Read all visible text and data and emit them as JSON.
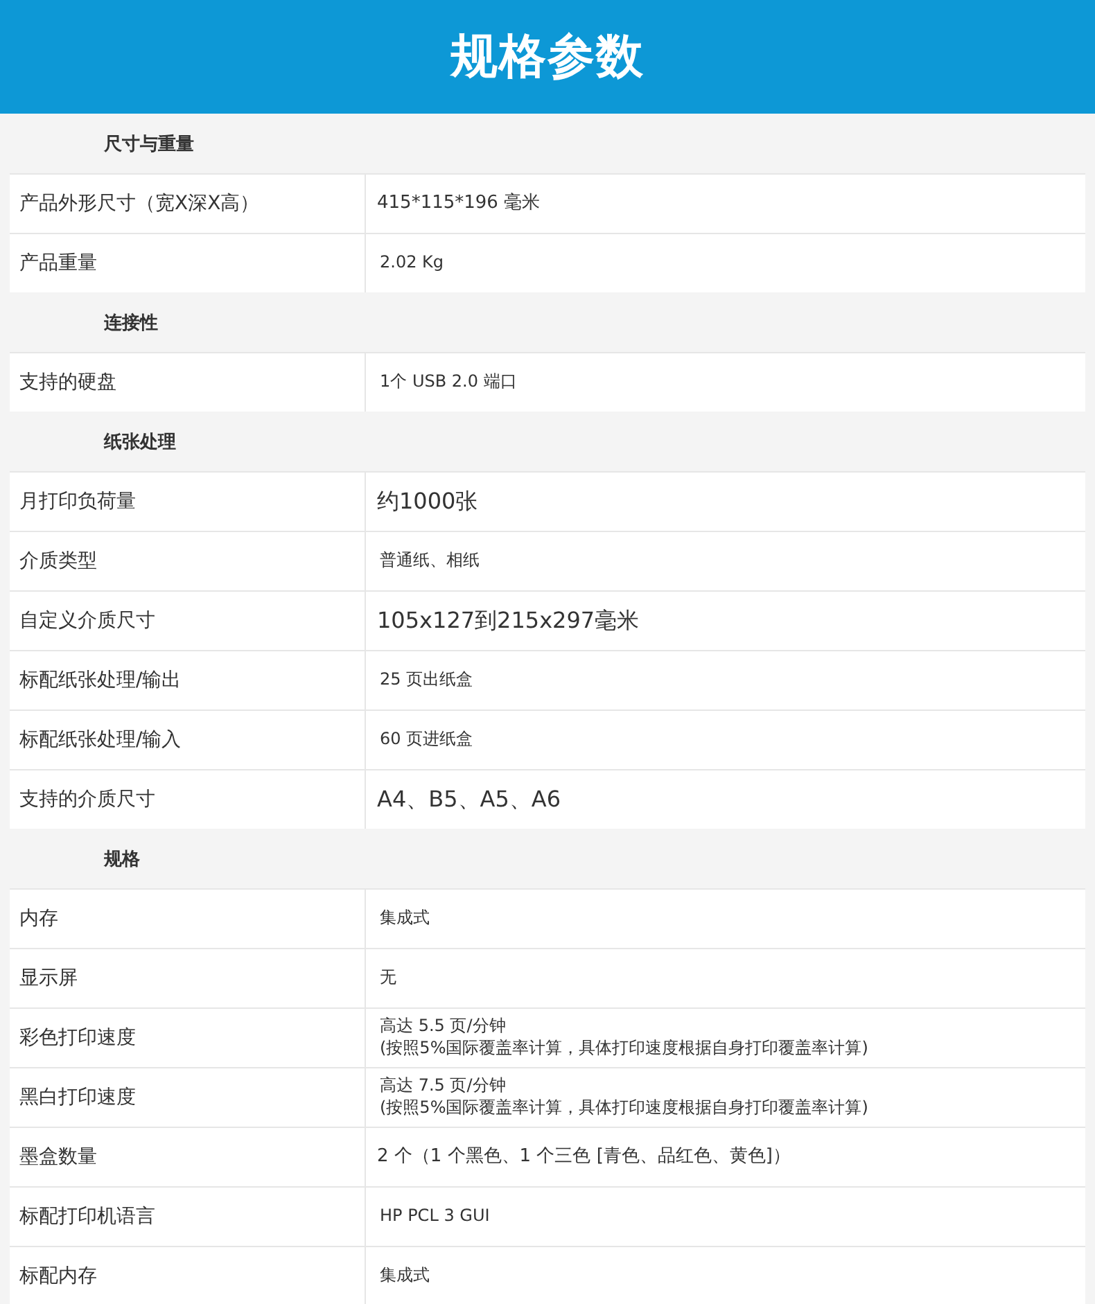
{
  "header": {
    "title": "规格参数"
  },
  "sections": [
    {
      "title": "尺寸与重量",
      "rows": [
        {
          "label": "产品外形尺寸（宽X深X高）",
          "kind": "medium",
          "lines": [
            "415*115*196  毫米"
          ]
        },
        {
          "label": "产品重量",
          "kind": "plain",
          "lines": [
            "2.02 Kg"
          ]
        }
      ]
    },
    {
      "title": "连接性",
      "rows": [
        {
          "label": "支持的硬盘",
          "kind": "plain",
          "lines": [
            "1个 USB 2.0 端口"
          ]
        }
      ]
    },
    {
      "title": "纸张处理",
      "rows": [
        {
          "label": "月打印负荷量",
          "kind": "large",
          "lines": [
            "约1000张"
          ]
        },
        {
          "label": "介质类型",
          "kind": "plain",
          "lines": [
            "普通纸、相纸"
          ]
        },
        {
          "label": "自定义介质尺寸",
          "kind": "large",
          "lines": [
            "105x127到215x297毫米"
          ]
        },
        {
          "label": "标配纸张处理/输出",
          "kind": "plain",
          "lines": [
            "25 页出纸盒"
          ]
        },
        {
          "label": "标配纸张处理/输入",
          "kind": "plain",
          "lines": [
            "60 页进纸盒"
          ]
        },
        {
          "label": "支持的介质尺寸",
          "kind": "large",
          "lines": [
            "A4、B5、A5、A6"
          ]
        }
      ]
    },
    {
      "title": "规格",
      "rows": [
        {
          "label": "内存",
          "kind": "plain",
          "lines": [
            "集成式"
          ]
        },
        {
          "label": "显示屏",
          "kind": "plain",
          "lines": [
            "无"
          ]
        },
        {
          "label": "彩色打印速度",
          "kind": "plain",
          "lines": [
            "高达 5.5 页/分钟",
            "(按照5%国际覆盖率计算，具体打印速度根据自身打印覆盖率计算)"
          ]
        },
        {
          "label": "黑白打印速度",
          "kind": "plain",
          "lines": [
            "高达 7.5 页/分钟",
            "(按照5%国际覆盖率计算，具体打印速度根据自身打印覆盖率计算)"
          ]
        },
        {
          "label": "墨盒数量",
          "kind": "medium",
          "lines": [
            "2 个（1 个黑色、1 个三色 [青色、品红色、黄色]）"
          ]
        },
        {
          "label": "标配打印机语言",
          "kind": "plain",
          "lines": [
            "HP PCL 3 GUI"
          ]
        },
        {
          "label": "标配内存",
          "kind": "plain",
          "lines": [
            "集成式"
          ]
        }
      ]
    }
  ]
}
